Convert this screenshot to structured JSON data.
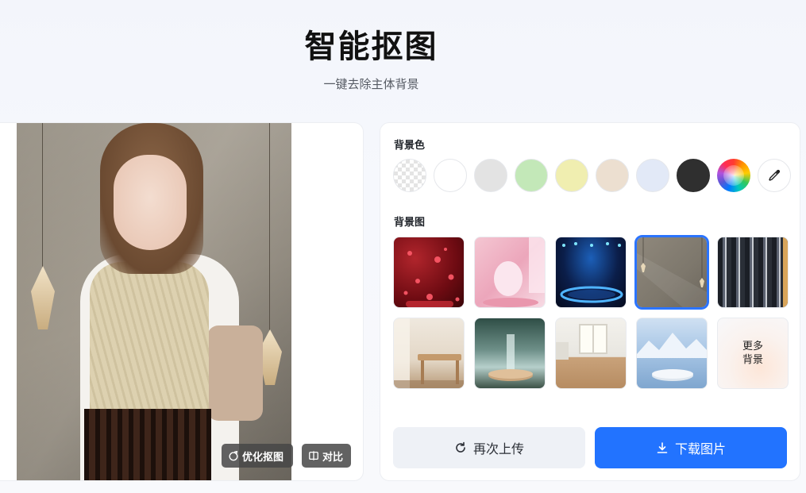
{
  "header": {
    "title": "智能抠图",
    "subtitle": "一键去除主体背景"
  },
  "preview": {
    "refine_label": "优化抠图",
    "compare_label": "对比"
  },
  "panel": {
    "bg_color_label": "背景色",
    "colors": [
      {
        "name": "transparent",
        "hex": "transparent"
      },
      {
        "name": "white",
        "hex": "#ffffff"
      },
      {
        "name": "light-gray",
        "hex": "#e3e3e3"
      },
      {
        "name": "light-green",
        "hex": "#c3e8b8"
      },
      {
        "name": "light-yellow",
        "hex": "#f0eeb0"
      },
      {
        "name": "beige",
        "hex": "#ecdfd0"
      },
      {
        "name": "light-blue",
        "hex": "#e2e9f7"
      },
      {
        "name": "dark",
        "hex": "#2f2f2f"
      },
      {
        "name": "custom-rainbow",
        "hex": "rainbow"
      },
      {
        "name": "eyedropper",
        "icon": "eyedropper-icon"
      }
    ],
    "bg_image_label": "背景图",
    "more_label": "更多\n背景",
    "selected_tile": 3,
    "reupload_label": "再次上传",
    "download_label": "下载图片",
    "accent_color": "#2273ff"
  }
}
